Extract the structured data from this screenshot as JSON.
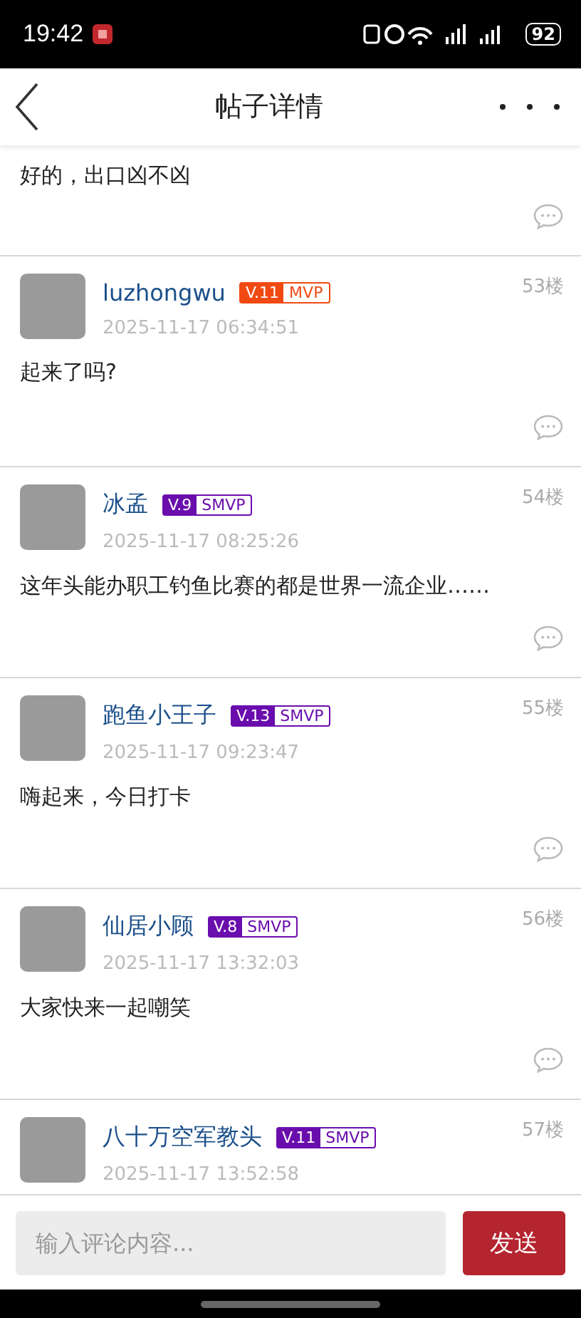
{
  "status_bar": {
    "time": "19:42",
    "battery": "92"
  },
  "header": {
    "title": "帖子详情"
  },
  "partial_post": {
    "content": "好的，出口凶不凶"
  },
  "posts": [
    {
      "user": "luzhongwu",
      "level": "V.11",
      "rank": "MVP",
      "color": "#f04a12",
      "date": "2025-11-17 06:34:51",
      "floor": "53楼",
      "content": "起来了吗?"
    },
    {
      "user": "冰孟",
      "level": "V.9",
      "rank": "SMVP",
      "color": "#6a0dad",
      "date": "2025-11-17 08:25:26",
      "floor": "54楼",
      "content": "这年头能办职工钓鱼比赛的都是世界一流企业……"
    },
    {
      "user": "跑鱼小王子",
      "level": "V.13",
      "rank": "SMVP",
      "color": "#6a0dad",
      "date": "2025-11-17 09:23:47",
      "floor": "55楼",
      "content": "嗨起来，今日打卡"
    },
    {
      "user": "仙居小顾",
      "level": "V.8",
      "rank": "SMVP",
      "color": "#6a0dad",
      "date": "2025-11-17 13:32:03",
      "floor": "56楼",
      "content": "大家快来一起嘲笑"
    },
    {
      "user": "八十万空军教头",
      "level": "V.11",
      "rank": "SMVP",
      "color": "#6a0dad",
      "date": "2025-11-17 13:52:58",
      "floor": "57楼"
    }
  ],
  "comment_bar": {
    "placeholder": "输入评论内容...",
    "send": "发送"
  }
}
